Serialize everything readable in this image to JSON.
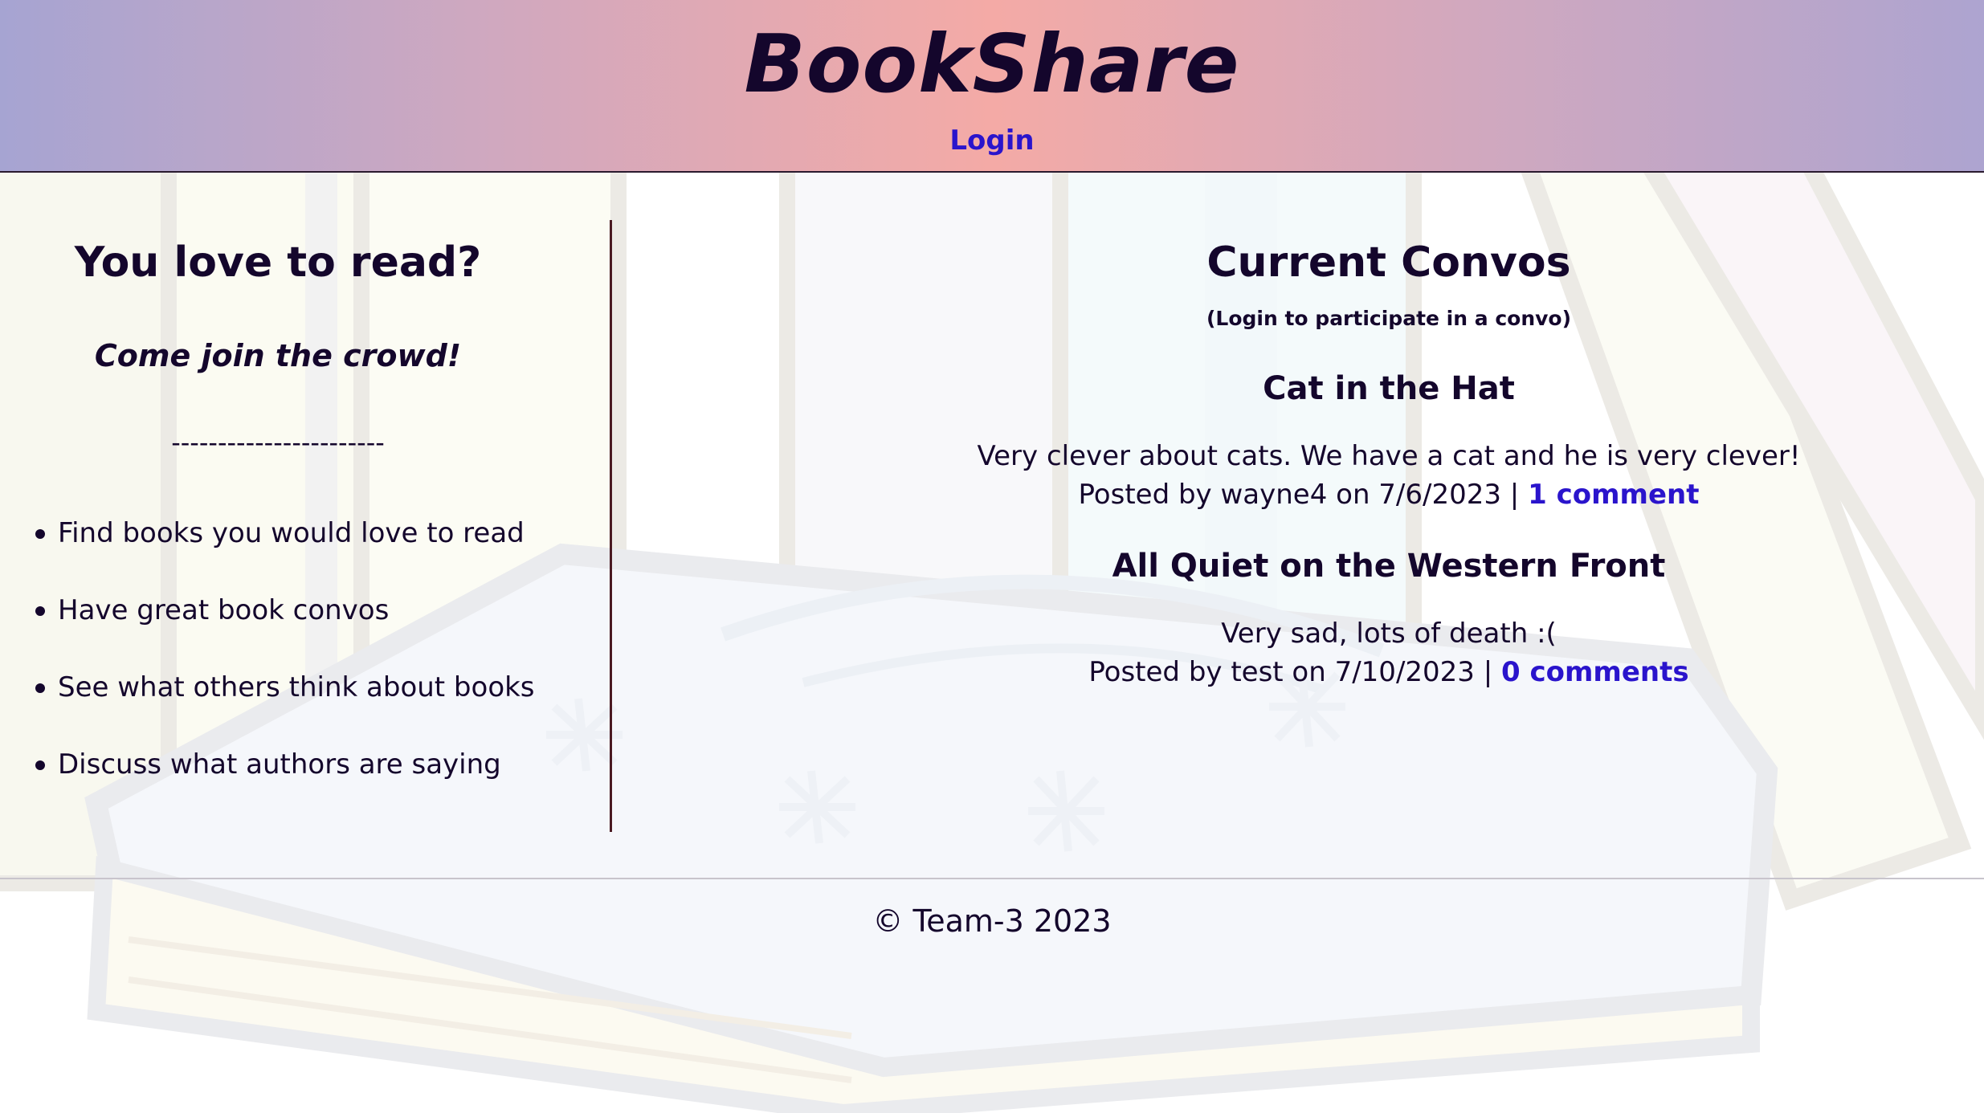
{
  "header": {
    "brand": "BookShare",
    "login_label": "Login"
  },
  "intro": {
    "title": "You love to read?",
    "subtitle": "Come join the crowd!",
    "divider": "-----------------------",
    "features": [
      "Find books you would love to read",
      "Have great book convos",
      "See what others think about books",
      "Discuss what authors are saying"
    ]
  },
  "convos": {
    "title": "Current Convos",
    "note": "(Login to participate in a convo)",
    "items": [
      {
        "title": "Cat in the Hat",
        "body": "Very clever about cats. We have a cat and he is very clever!",
        "meta": "Posted by wayne4 on 7/6/2023 | ",
        "comments_label": "1 comment"
      },
      {
        "title": "All Quiet on the Western Front",
        "body": "Very sad, lots of death :(",
        "meta": "Posted by test on 7/10/2023 | ",
        "comments_label": "0 comments"
      }
    ]
  },
  "footer": {
    "text": "© Team-3 2023"
  },
  "colors": {
    "link": "#2a14cc",
    "text": "#14062c",
    "header_gradient_center": "#f4aaa6",
    "header_gradient_edge": "#a6a4d2"
  }
}
